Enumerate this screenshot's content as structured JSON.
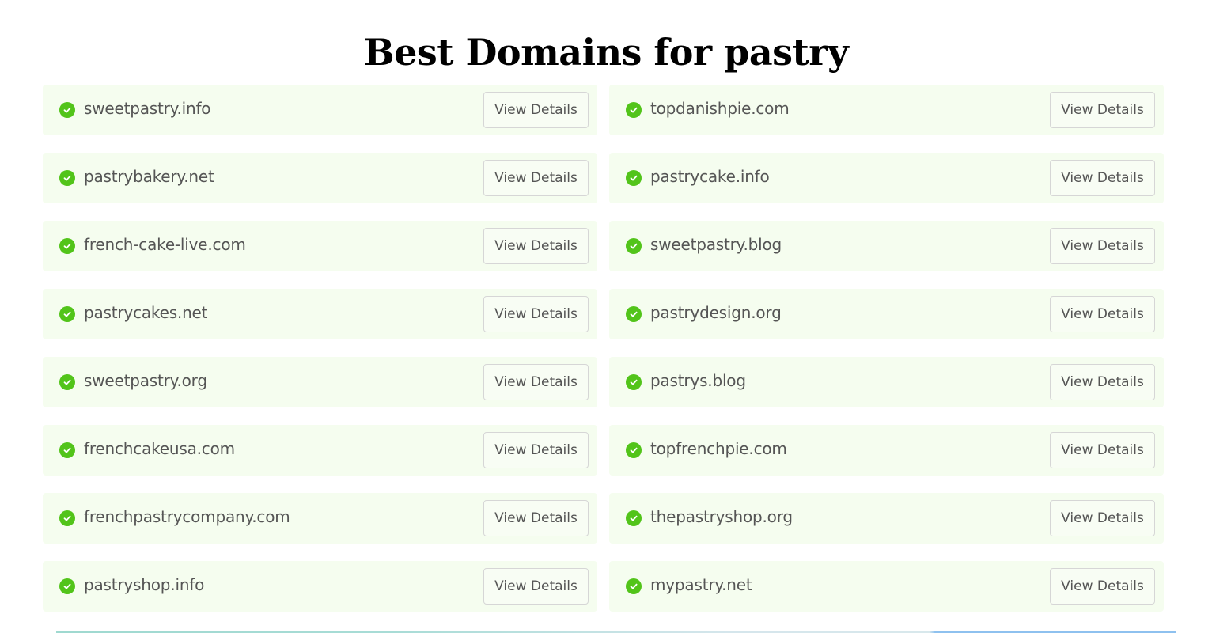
{
  "header": {
    "title_prefix": "Best Domains for ",
    "title_keyword": "pastry"
  },
  "button_label": "View Details",
  "icon": "check-circle-icon",
  "colors": {
    "card_bg": "#f5fdef",
    "check": "#52c41a",
    "text": "#555555"
  },
  "domains": [
    {
      "name": "sweetpastry.info",
      "available": true
    },
    {
      "name": "topdanishpie.com",
      "available": true
    },
    {
      "name": "pastrybakery.net",
      "available": true
    },
    {
      "name": "pastrycake.info",
      "available": true
    },
    {
      "name": "french-cake-live.com",
      "available": true
    },
    {
      "name": "sweetpastry.blog",
      "available": true
    },
    {
      "name": "pastrycakes.net",
      "available": true
    },
    {
      "name": "pastrydesign.org",
      "available": true
    },
    {
      "name": "sweetpastry.org",
      "available": true
    },
    {
      "name": "pastrys.blog",
      "available": true
    },
    {
      "name": "frenchcakeusa.com",
      "available": true
    },
    {
      "name": "topfrenchpie.com",
      "available": true
    },
    {
      "name": "frenchpastrycompany.com",
      "available": true
    },
    {
      "name": "thepastryshop.org",
      "available": true
    },
    {
      "name": "pastryshop.info",
      "available": true
    },
    {
      "name": "mypastry.net",
      "available": true
    }
  ]
}
